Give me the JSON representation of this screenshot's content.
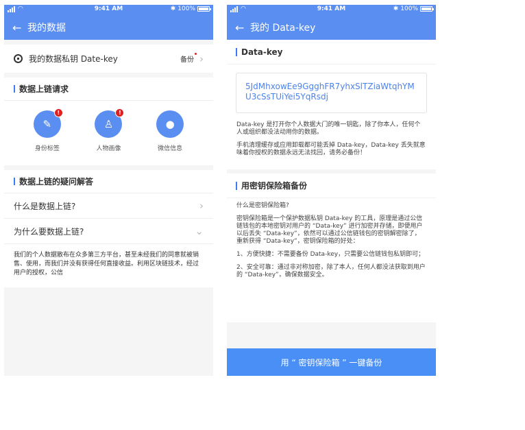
{
  "status": {
    "time": "9:41 AM",
    "battery": "100%"
  },
  "left": {
    "nav_title": "我的数据",
    "key_row": {
      "label": "我的数据私钥 Date-key",
      "action": "备份"
    },
    "chain_requests": {
      "heading": "数据上链请求",
      "items": [
        {
          "label": "身份标签",
          "icon": "pencil-icon",
          "badge": "!"
        },
        {
          "label": "人物画像",
          "icon": "person-icon",
          "badge": "!"
        },
        {
          "label": "微信信息",
          "icon": "wechat-icon"
        }
      ]
    },
    "faq": {
      "heading": "数据上链的疑问解答",
      "items": [
        {
          "question": "什么是数据上链?"
        },
        {
          "question": "为什么要数据上链?"
        }
      ],
      "answer": "我们的个人数据散布在众多第三方平台，甚至未经我们的同意就被销售、使用，而我们并没有获得任何直接收益。利用区块链技术，经过用户的授权，公信"
    }
  },
  "right": {
    "nav_title": "我的 Data-key",
    "key_heading": "Data-key",
    "key_value": "5JdMhxowEe9GgghFR7yhxSlTZiaWtqhYMU3cSsTUiYei5YqRsdj",
    "desc1": "Data-key 是打开你个人数据大门的唯一钥匙，除了你本人，任何个人或组织都没法动用你的数据。",
    "desc2": "手机清理缓存或应用卸载都可能丢掉 Data-key，Data-key 丢失就意味着你授权的数据永远无法找回，请务必备份！",
    "vault_heading": "用密钥保险箱备份",
    "vault_q": "什么是密钥保险箱?",
    "vault_p1": "密钥保险箱是一个保护数据私钥 Data-key 的工具，原理是通过公信链钱包的本地密钥对用户的 “Data-key” 进行加密并存储，即便用户以后丢失 “Data-key”，依然可以通过公信链钱包的密钥解密除了，重新获得 “Data-key”，密钥保险箱的好处：",
    "vault_p2": "1、方便快捷：不需要备份 Data-key，只需要公信链钱包私钥即可；",
    "vault_p3": "2、安全可靠：通过非对称加密，除了本人，任何人都没法获取到用户的 “Data-key”，确保数据安全。",
    "button": "用 “ 密钥保险箱 ” 一键备份"
  }
}
